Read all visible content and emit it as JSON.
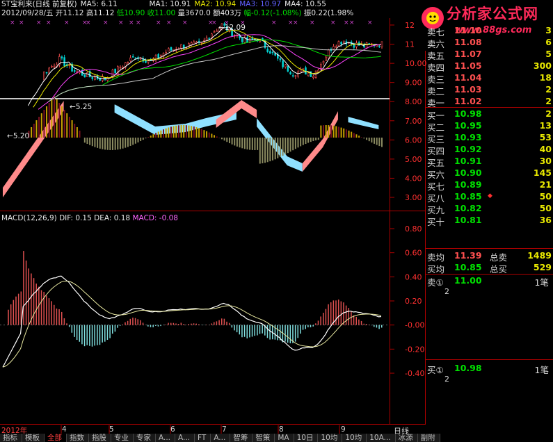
{
  "header": {
    "stock_name": "ST宝利来(日线 前复权)",
    "ma5": "MA5: 6.11",
    "ma1": "MA1: 10.91",
    "ma2": "MA2: 10.94",
    "ma3": "MA3: 10.97",
    "ma4": "MA4: 10.55"
  },
  "ohlc": {
    "date": "2012/09/28/五",
    "open": "开11.12",
    "high": "高11.12",
    "low": "低10.90",
    "close": "收11.00",
    "volume": "量3670.0",
    "amount": "额403万",
    "change": "幅-0.12(-1.08%)",
    "amplitude": "振0.22(1.98%"
  },
  "macd": {
    "title": "MACD(12,26,9)",
    "dif": "DIF: 0.15",
    "dea": "DEA: 0.18",
    "macd": "MACD: -0.08"
  },
  "price_chart": {
    "annotation_high": "12.09",
    "annotation_low_a": "5.25",
    "annotation_low_b": "5.20",
    "y_ticks": [
      "12",
      "11.00",
      "10.00",
      "9.00",
      "8.00",
      "7.00",
      "6.00",
      "5.00",
      "4.00",
      "3.00"
    ]
  },
  "macd_chart": {
    "y_ticks": [
      "0.80",
      "0.60",
      "0.40",
      "0.20",
      "-0.00",
      "-0.20",
      "-0.40"
    ]
  },
  "time_axis": {
    "year": "2012年",
    "months": [
      "4",
      "5",
      "6",
      "7",
      "8",
      "9"
    ],
    "period": "日线"
  },
  "tabs": [
    "指标",
    "模板",
    "全部",
    "指数",
    "指股",
    "专业",
    "专家",
    "A...",
    "A...",
    "FT",
    "A...",
    "智筹",
    "智策",
    "MA",
    "10日",
    "10均",
    "10均",
    "10A...",
    "冰源",
    "副附"
  ],
  "logo": {
    "title": "分析家公式网",
    "url": "www.88gs.com"
  },
  "order_book": {
    "sell": [
      {
        "label": "卖七",
        "price": "11.10",
        "vol": "3",
        "dir": "up"
      },
      {
        "label": "卖六",
        "price": "11.08",
        "vol": "6",
        "dir": "up"
      },
      {
        "label": "卖五",
        "price": "11.07",
        "vol": "5",
        "dir": "up"
      },
      {
        "label": "卖四",
        "price": "11.05",
        "vol": "300",
        "dir": "up"
      },
      {
        "label": "卖三",
        "price": "11.04",
        "vol": "18",
        "dir": "up"
      },
      {
        "label": "卖二",
        "price": "11.03",
        "vol": "2",
        "dir": "up"
      },
      {
        "label": "卖一",
        "price": "11.02",
        "vol": "2",
        "dir": "up"
      }
    ],
    "buy": [
      {
        "label": "买一",
        "price": "10.98",
        "vol": "2",
        "dir": "down"
      },
      {
        "label": "买二",
        "price": "10.95",
        "vol": "13",
        "dir": "down"
      },
      {
        "label": "买三",
        "price": "10.93",
        "vol": "53",
        "dir": "down"
      },
      {
        "label": "买四",
        "price": "10.92",
        "vol": "40",
        "dir": "down"
      },
      {
        "label": "买五",
        "price": "10.91",
        "vol": "30",
        "dir": "down"
      },
      {
        "label": "买六",
        "price": "10.90",
        "vol": "145",
        "dir": "down"
      },
      {
        "label": "买七",
        "price": "10.89",
        "vol": "21",
        "dir": "down"
      },
      {
        "label": "买八",
        "price": "10.85",
        "vol": "50",
        "dir": "down"
      },
      {
        "label": "买九",
        "price": "10.82",
        "vol": "50",
        "dir": "down"
      },
      {
        "label": "买十",
        "price": "10.81",
        "vol": "36",
        "dir": "down"
      }
    ],
    "sell_avg": {
      "label": "卖均",
      "price": "11.39",
      "total_label": "总卖",
      "total": "1489"
    },
    "buy_avg": {
      "label": "买均",
      "price": "10.85",
      "total_label": "总买",
      "total": "529"
    },
    "sell_queue": {
      "label": "卖①",
      "price": "11.00",
      "count_label": "1笔",
      "sub": "2"
    },
    "buy_queue": {
      "label": "买①",
      "price": "10.98",
      "count_label": "1笔",
      "sub": "2"
    }
  },
  "colors": {
    "up": "#ff5050",
    "down": "#00e000",
    "grid": "#a00000",
    "bg": "#000000"
  }
}
